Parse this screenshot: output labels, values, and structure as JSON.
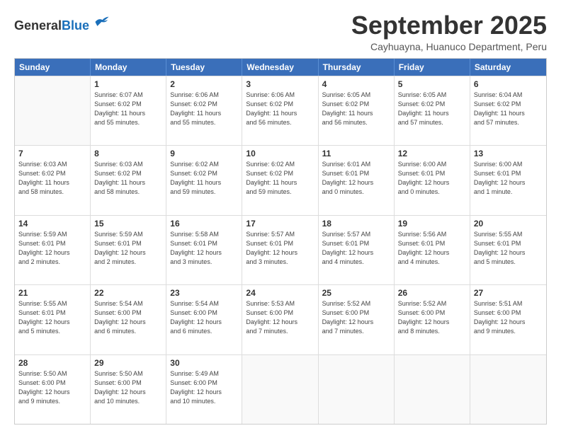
{
  "header": {
    "logo_general": "General",
    "logo_blue": "Blue",
    "month_title": "September 2025",
    "location": "Cayhuayna, Huanuco Department, Peru"
  },
  "weekdays": [
    "Sunday",
    "Monday",
    "Tuesday",
    "Wednesday",
    "Thursday",
    "Friday",
    "Saturday"
  ],
  "weeks": [
    [
      {
        "day": "",
        "info": ""
      },
      {
        "day": "1",
        "info": "Sunrise: 6:07 AM\nSunset: 6:02 PM\nDaylight: 11 hours\nand 55 minutes."
      },
      {
        "day": "2",
        "info": "Sunrise: 6:06 AM\nSunset: 6:02 PM\nDaylight: 11 hours\nand 55 minutes."
      },
      {
        "day": "3",
        "info": "Sunrise: 6:06 AM\nSunset: 6:02 PM\nDaylight: 11 hours\nand 56 minutes."
      },
      {
        "day": "4",
        "info": "Sunrise: 6:05 AM\nSunset: 6:02 PM\nDaylight: 11 hours\nand 56 minutes."
      },
      {
        "day": "5",
        "info": "Sunrise: 6:05 AM\nSunset: 6:02 PM\nDaylight: 11 hours\nand 57 minutes."
      },
      {
        "day": "6",
        "info": "Sunrise: 6:04 AM\nSunset: 6:02 PM\nDaylight: 11 hours\nand 57 minutes."
      }
    ],
    [
      {
        "day": "7",
        "info": "Sunrise: 6:03 AM\nSunset: 6:02 PM\nDaylight: 11 hours\nand 58 minutes."
      },
      {
        "day": "8",
        "info": "Sunrise: 6:03 AM\nSunset: 6:02 PM\nDaylight: 11 hours\nand 58 minutes."
      },
      {
        "day": "9",
        "info": "Sunrise: 6:02 AM\nSunset: 6:02 PM\nDaylight: 11 hours\nand 59 minutes."
      },
      {
        "day": "10",
        "info": "Sunrise: 6:02 AM\nSunset: 6:02 PM\nDaylight: 11 hours\nand 59 minutes."
      },
      {
        "day": "11",
        "info": "Sunrise: 6:01 AM\nSunset: 6:01 PM\nDaylight: 12 hours\nand 0 minutes."
      },
      {
        "day": "12",
        "info": "Sunrise: 6:00 AM\nSunset: 6:01 PM\nDaylight: 12 hours\nand 0 minutes."
      },
      {
        "day": "13",
        "info": "Sunrise: 6:00 AM\nSunset: 6:01 PM\nDaylight: 12 hours\nand 1 minute."
      }
    ],
    [
      {
        "day": "14",
        "info": "Sunrise: 5:59 AM\nSunset: 6:01 PM\nDaylight: 12 hours\nand 2 minutes."
      },
      {
        "day": "15",
        "info": "Sunrise: 5:59 AM\nSunset: 6:01 PM\nDaylight: 12 hours\nand 2 minutes."
      },
      {
        "day": "16",
        "info": "Sunrise: 5:58 AM\nSunset: 6:01 PM\nDaylight: 12 hours\nand 3 minutes."
      },
      {
        "day": "17",
        "info": "Sunrise: 5:57 AM\nSunset: 6:01 PM\nDaylight: 12 hours\nand 3 minutes."
      },
      {
        "day": "18",
        "info": "Sunrise: 5:57 AM\nSunset: 6:01 PM\nDaylight: 12 hours\nand 4 minutes."
      },
      {
        "day": "19",
        "info": "Sunrise: 5:56 AM\nSunset: 6:01 PM\nDaylight: 12 hours\nand 4 minutes."
      },
      {
        "day": "20",
        "info": "Sunrise: 5:55 AM\nSunset: 6:01 PM\nDaylight: 12 hours\nand 5 minutes."
      }
    ],
    [
      {
        "day": "21",
        "info": "Sunrise: 5:55 AM\nSunset: 6:01 PM\nDaylight: 12 hours\nand 5 minutes."
      },
      {
        "day": "22",
        "info": "Sunrise: 5:54 AM\nSunset: 6:00 PM\nDaylight: 12 hours\nand 6 minutes."
      },
      {
        "day": "23",
        "info": "Sunrise: 5:54 AM\nSunset: 6:00 PM\nDaylight: 12 hours\nand 6 minutes."
      },
      {
        "day": "24",
        "info": "Sunrise: 5:53 AM\nSunset: 6:00 PM\nDaylight: 12 hours\nand 7 minutes."
      },
      {
        "day": "25",
        "info": "Sunrise: 5:52 AM\nSunset: 6:00 PM\nDaylight: 12 hours\nand 7 minutes."
      },
      {
        "day": "26",
        "info": "Sunrise: 5:52 AM\nSunset: 6:00 PM\nDaylight: 12 hours\nand 8 minutes."
      },
      {
        "day": "27",
        "info": "Sunrise: 5:51 AM\nSunset: 6:00 PM\nDaylight: 12 hours\nand 9 minutes."
      }
    ],
    [
      {
        "day": "28",
        "info": "Sunrise: 5:50 AM\nSunset: 6:00 PM\nDaylight: 12 hours\nand 9 minutes."
      },
      {
        "day": "29",
        "info": "Sunrise: 5:50 AM\nSunset: 6:00 PM\nDaylight: 12 hours\nand 10 minutes."
      },
      {
        "day": "30",
        "info": "Sunrise: 5:49 AM\nSunset: 6:00 PM\nDaylight: 12 hours\nand 10 minutes."
      },
      {
        "day": "",
        "info": ""
      },
      {
        "day": "",
        "info": ""
      },
      {
        "day": "",
        "info": ""
      },
      {
        "day": "",
        "info": ""
      }
    ]
  ]
}
